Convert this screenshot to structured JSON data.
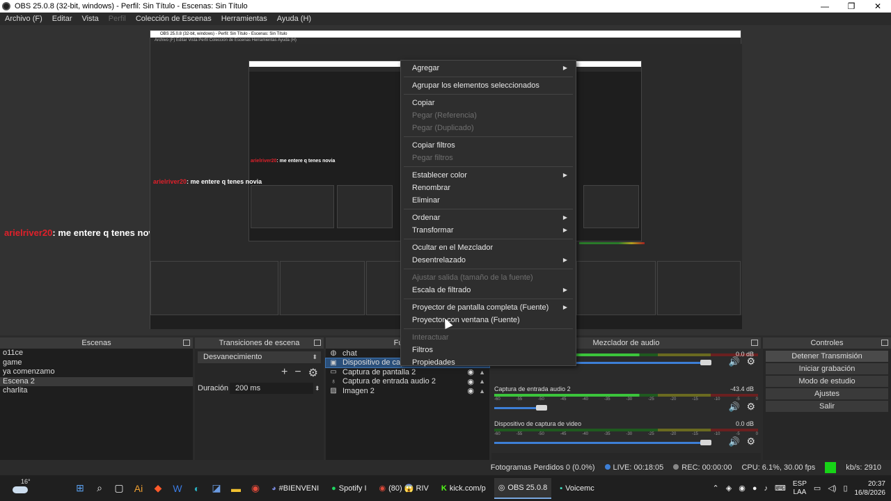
{
  "window": {
    "title": "OBS 25.0.8 (32-bit, windows) - Perfil: Sin Título - Escenas: Sin Título",
    "minimize": "—",
    "maximize": "❐",
    "close": "✕"
  },
  "menu": [
    "Archivo (F)",
    "Editar",
    "Vista",
    "Perfil",
    "Colección de Escenas",
    "Herramientas",
    "Ayuda (H)"
  ],
  "nested": {
    "title": "OBS 25.0.8 (32-bit, windows) - Perfil: Sin Título - Escenas: Sin Título",
    "menu": "Archivo (F)   Editar   Vista   Perfil   Colección de Escenas   Herramientas   Ayuda (H)"
  },
  "chat": {
    "user": "arielriver20",
    "message": ": me entere q tenes novia"
  },
  "docks": {
    "scenes": {
      "title": "Escenas",
      "items": [
        "o11ce",
        "game",
        "ya comenzamo",
        "Escena 2",
        "charlita"
      ],
      "selected": 3
    },
    "transitions": {
      "title": "Transiciones de escena",
      "transition": "Desvanecimiento",
      "duration_label": "Duración",
      "duration_value": "200 ms"
    },
    "sources": {
      "title": "Fuentes",
      "items": [
        {
          "name": "chat",
          "icon": "globe-icon"
        },
        {
          "name": "Dispositivo de captura de video",
          "icon": "camera-icon"
        },
        {
          "name": "Captura de pantalla 2",
          "icon": "monitor-icon"
        },
        {
          "name": "Captura de entrada audio 2",
          "icon": "microphone-icon"
        },
        {
          "name": "Imagen 2",
          "icon": "image-icon"
        }
      ]
    },
    "mixer": {
      "title": "Mezclador de audio",
      "channels": [
        {
          "name": "",
          "db": "0.0 dB",
          "level": 0.98
        },
        {
          "name": "Captura de entrada audio 2",
          "db": "-43.4 dB",
          "level": 0.22
        },
        {
          "name": "Dispositivo de captura de video",
          "db": "0.0 dB",
          "level": 0.98
        }
      ],
      "scale": [
        "-60",
        "-55",
        "-50",
        "-45",
        "-40",
        "-35",
        "-30",
        "-25",
        "-20",
        "-15",
        "-10",
        "-5",
        "0"
      ]
    },
    "controls": {
      "title": "Controles",
      "buttons": [
        "Detener Transmisión",
        "Iniciar grabación",
        "Modo de estudio",
        "Ajustes",
        "Salir"
      ]
    }
  },
  "status": {
    "dropped": "Fotogramas Perdidos 0 (0.0%)",
    "live": "LIVE: 00:18:05",
    "rec": "REC: 00:00:00",
    "cpu": "CPU: 6.1%, 30.00 fps",
    "kbps": "kb/s: 2910"
  },
  "context_menu": [
    {
      "label": "Agregar",
      "submenu": true
    },
    {
      "sep": true
    },
    {
      "label": "Agrupar los elementos seleccionados"
    },
    {
      "sep": true
    },
    {
      "label": "Copiar"
    },
    {
      "label": "Pegar (Referencia)",
      "disabled": true
    },
    {
      "label": "Pegar (Duplicado)",
      "disabled": true
    },
    {
      "sep": true
    },
    {
      "label": "Copiar filtros"
    },
    {
      "label": "Pegar filtros",
      "disabled": true
    },
    {
      "sep": true
    },
    {
      "label": "Establecer color",
      "submenu": true
    },
    {
      "label": "Renombrar"
    },
    {
      "label": "Eliminar"
    },
    {
      "sep": true
    },
    {
      "label": "Ordenar",
      "submenu": true
    },
    {
      "label": "Transformar",
      "submenu": true
    },
    {
      "sep": true
    },
    {
      "label": "Ocultar en el Mezclador"
    },
    {
      "label": "Desentrelazado",
      "submenu": true
    },
    {
      "sep": true
    },
    {
      "label": "Ajustar salida (tamaño de la fuente)",
      "disabled": true
    },
    {
      "label": "Escala de filtrado",
      "submenu": true
    },
    {
      "sep": true
    },
    {
      "label": "Proyector de pantalla completa (Fuente)",
      "submenu": true
    },
    {
      "label": "Proyector con ventana (Fuente)"
    },
    {
      "sep": true
    },
    {
      "label": "Interactuar",
      "disabled": true
    },
    {
      "label": "Filtros"
    },
    {
      "label": "Propiedades"
    }
  ],
  "taskbar": {
    "temperature": "16°",
    "apps": [
      {
        "label": "#BIENVENI",
        "icon": "discord-icon"
      },
      {
        "label": "Spotify I",
        "icon": "spotify-icon"
      },
      {
        "label": "(80) 😱 RIV",
        "icon": "chrome-icon"
      },
      {
        "label": "kick.com/p",
        "icon": "kick-icon"
      },
      {
        "label": "OBS 25.0.8",
        "icon": "obs-icon",
        "active": true
      },
      {
        "label": "Voicemc",
        "icon": "voicemod-icon"
      }
    ],
    "lang1": "ESP",
    "lang2": "LAA",
    "time": "20:37",
    "date": "16/8/2026"
  }
}
